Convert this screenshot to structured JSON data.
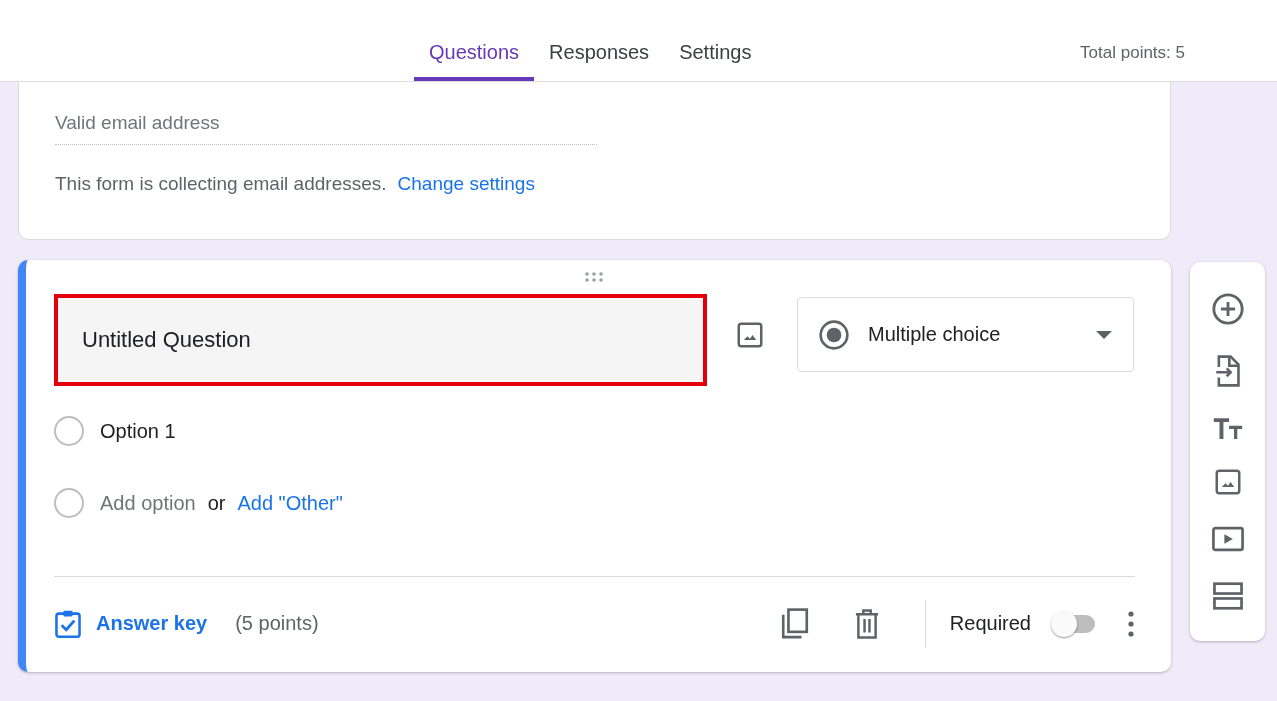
{
  "tabs": [
    {
      "label": "Questions",
      "selected": true
    },
    {
      "label": "Responses",
      "selected": false
    },
    {
      "label": "Settings",
      "selected": false
    }
  ],
  "total_points": "Total points: 5",
  "email_card": {
    "placeholder": "Valid email address",
    "notice": "This form is collecting email addresses.",
    "link": "Change settings"
  },
  "question": {
    "title": "Untitled Question",
    "highlighted": true,
    "type": {
      "label": "Multiple choice"
    },
    "options": [
      {
        "kind": "option",
        "label": "Option 1",
        "selected": false
      },
      {
        "kind": "add",
        "label": "Add option",
        "selected": false,
        "joiner": "or",
        "link": "Add \"Other\""
      }
    ],
    "answer_key": "Answer key",
    "points": "(5 points)",
    "required": {
      "label": "Required",
      "on": false
    }
  }
}
